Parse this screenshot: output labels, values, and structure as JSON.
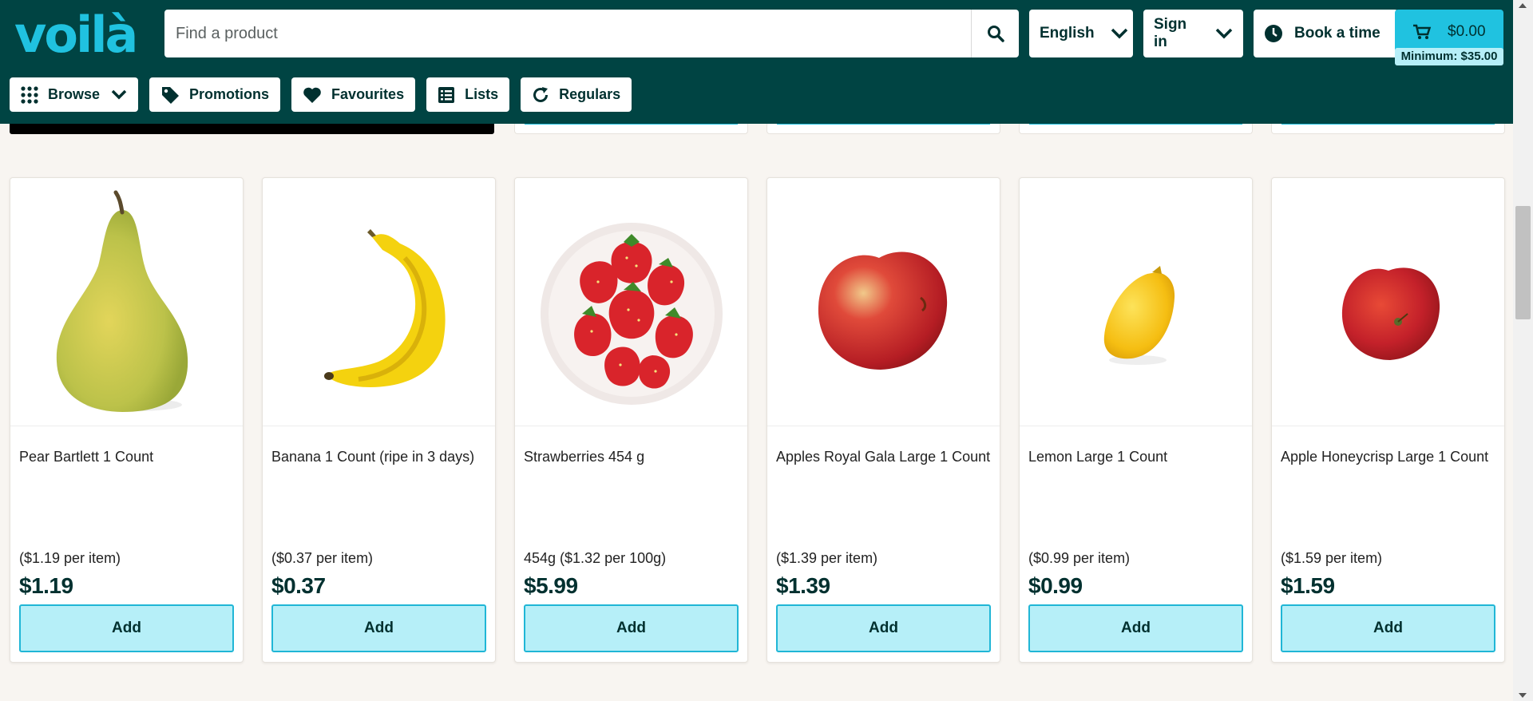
{
  "brand": {
    "logo": "voilà",
    "accent": "#20c2e0",
    "header_bg": "#004443"
  },
  "search": {
    "placeholder": "Find a product",
    "icon": "search-icon"
  },
  "header": {
    "language_label": "English",
    "signin_label": "Sign in",
    "book_label": "Book a time",
    "cart_total": "$0.00",
    "cart_minimum": "Minimum: $35.00"
  },
  "nav": {
    "browse": "Browse",
    "promotions": "Promotions",
    "favourites": "Favourites",
    "lists": "Lists",
    "regulars": "Regulars"
  },
  "products": [
    {
      "name": "Pear Bartlett 1 Count",
      "unit_price": "($1.19 per item)",
      "price": "$1.19",
      "add_label": "Add",
      "image": "pear"
    },
    {
      "name": "Banana 1 Count (ripe in 3 days)",
      "unit_price": "($0.37 per item)",
      "price": "$0.37",
      "add_label": "Add",
      "image": "banana"
    },
    {
      "name": "Strawberries 454 g",
      "unit_price": "454g ($1.32 per 100g)",
      "price": "$5.99",
      "add_label": "Add",
      "image": "strawberries"
    },
    {
      "name": "Apples Royal Gala Large 1 Count",
      "unit_price": "($1.39 per item)",
      "price": "$1.39",
      "add_label": "Add",
      "image": "apple-gala"
    },
    {
      "name": "Lemon Large 1 Count",
      "unit_price": "($0.99 per item)",
      "price": "$0.99",
      "add_label": "Add",
      "image": "lemon"
    },
    {
      "name": "Apple Honeycrisp Large 1 Count",
      "unit_price": "($1.59 per item)",
      "price": "$1.59",
      "add_label": "Add",
      "image": "apple-honeycrisp"
    }
  ]
}
